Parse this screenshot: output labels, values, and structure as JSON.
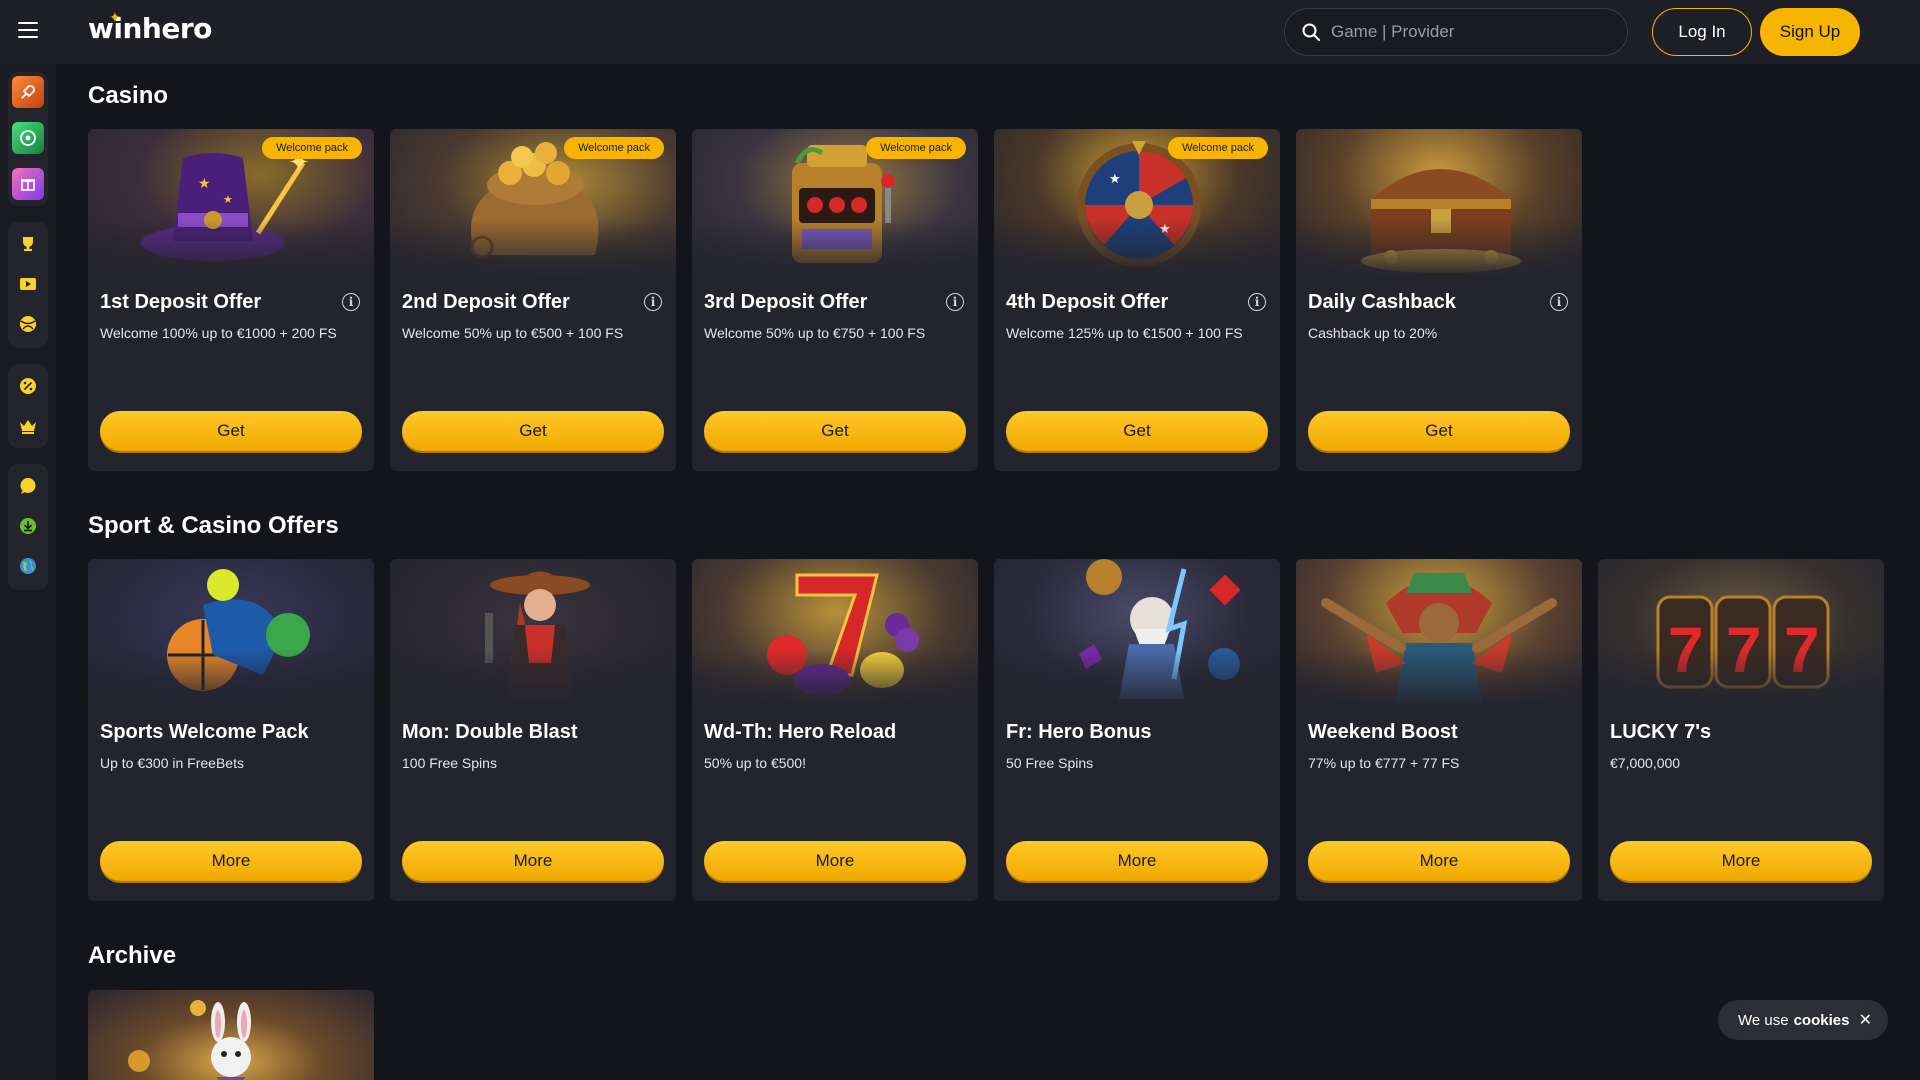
{
  "header": {
    "logo": "winhero",
    "search_placeholder": "Game | Provider",
    "login_label": "Log In",
    "signup_label": "Sign Up"
  },
  "sidebar": {
    "icons": [
      "rocket-icon",
      "roulette-icon",
      "gift-box-icon",
      "trophy-icon",
      "video-play-icon",
      "sports-ball-icon",
      "percent-badge-icon",
      "crown-icon",
      "chat-icon",
      "download-icon",
      "globe-icon"
    ]
  },
  "sections": {
    "casino": {
      "title": "Casino",
      "cards": [
        {
          "title": "1st Deposit Offer",
          "subtitle": "Welcome 100% up to €1000 + 200 FS",
          "badge": "Welcome pack",
          "button": "Get"
        },
        {
          "title": "2nd Deposit Offer",
          "subtitle": "Welcome 50% up to €500 + 100 FS",
          "badge": "Welcome pack",
          "button": "Get"
        },
        {
          "title": "3rd Deposit Offer",
          "subtitle": "Welcome 50% up to €750 + 100 FS",
          "badge": "Welcome pack",
          "button": "Get"
        },
        {
          "title": "4th Deposit Offer",
          "subtitle": "Welcome 125% up to €1500 + 100 FS",
          "badge": "Welcome pack",
          "button": "Get"
        },
        {
          "title": "Daily Cashback",
          "subtitle": "Cashback up to 20%",
          "badge": "",
          "button": "Get"
        }
      ]
    },
    "sport_casino": {
      "title": "Sport & Casino Offers",
      "cards": [
        {
          "title": "Sports Welcome Pack",
          "subtitle": "Up to €300 in FreeBets",
          "button": "More"
        },
        {
          "title": "Mon: Double Blast",
          "subtitle": "100 Free Spins",
          "button": "More"
        },
        {
          "title": "Wd-Th: Hero Reload",
          "subtitle": "50% up to €500!",
          "button": "More"
        },
        {
          "title": "Fr: Hero Bonus",
          "subtitle": "50 Free Spins",
          "button": "More"
        },
        {
          "title": "Weekend Boost",
          "subtitle": "77% up to €777 + 77 FS",
          "button": "More"
        },
        {
          "title": "LUCKY 7's",
          "subtitle": "€7,000,000",
          "button": "More"
        }
      ]
    },
    "archive": {
      "title": "Archive"
    }
  },
  "cookie": {
    "text": "We use",
    "link": "cookies",
    "close": "✕"
  },
  "colors": {
    "accent": "#f7b500",
    "background": "#14151b",
    "card": "#23242e",
    "header": "#1e1f26"
  }
}
